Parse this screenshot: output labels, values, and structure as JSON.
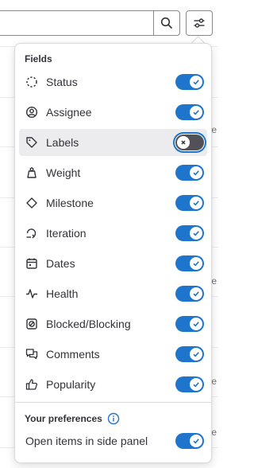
{
  "background": {
    "row_meta_text": "te"
  },
  "search": {
    "value": ""
  },
  "dropdown": {
    "fields_header": "Fields",
    "items": [
      {
        "label": "Status",
        "icon": "status-icon",
        "enabled": true
      },
      {
        "label": "Assignee",
        "icon": "assignee-icon",
        "enabled": true
      },
      {
        "label": "Labels",
        "icon": "label-icon",
        "enabled": false
      },
      {
        "label": "Weight",
        "icon": "weight-icon",
        "enabled": true
      },
      {
        "label": "Milestone",
        "icon": "milestone-icon",
        "enabled": true
      },
      {
        "label": "Iteration",
        "icon": "iteration-icon",
        "enabled": true
      },
      {
        "label": "Dates",
        "icon": "calendar-icon",
        "enabled": true
      },
      {
        "label": "Health",
        "icon": "health-icon",
        "enabled": true
      },
      {
        "label": "Blocked/Blocking",
        "icon": "blocked-icon",
        "enabled": true
      },
      {
        "label": "Comments",
        "icon": "comments-icon",
        "enabled": true
      },
      {
        "label": "Popularity",
        "icon": "thumb-up-icon",
        "enabled": true
      }
    ],
    "preferences_header": "Your preferences",
    "preferences": [
      {
        "label": "Open items in side panel",
        "enabled": true
      }
    ]
  },
  "colors": {
    "toggle_on": "#1f75cb",
    "toggle_off": "#535158",
    "highlight_row": "#ececef"
  }
}
